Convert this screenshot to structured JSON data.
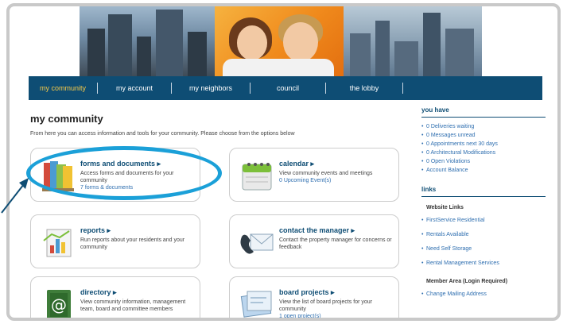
{
  "nav": {
    "items": [
      {
        "label": "my community",
        "active": true
      },
      {
        "label": "my account"
      },
      {
        "label": "my neighbors"
      },
      {
        "label": "council"
      },
      {
        "label": "the lobby"
      }
    ]
  },
  "main": {
    "title": "my community",
    "intro": "From here you can access information and tools for your community. Please choose from the options below",
    "cards": [
      {
        "title": "forms and documents ▸",
        "desc": "Access forms and documents for your community",
        "sub": "7 forms & documents",
        "icon": "folders-icon"
      },
      {
        "title": "calendar ▸",
        "desc": "View community events and meetings",
        "sub": "0 Upcoming Event(s)",
        "icon": "calendar-icon"
      },
      {
        "title": "reports ▸",
        "desc": "Run reports about your residents and your community",
        "sub": "",
        "icon": "chart-report-icon"
      },
      {
        "title": "contact the manager ▸",
        "desc": "Contact the property manager for concerns or feedback",
        "sub": "",
        "icon": "phone-envelope-icon"
      },
      {
        "title": "directory ▸",
        "desc": "View community information, management team, board and committee members",
        "sub": "",
        "icon": "at-book-icon"
      },
      {
        "title": "board projects ▸",
        "desc": "View the list of board projects for your community",
        "sub": "1 open project(s)",
        "icon": "blueprint-icon"
      }
    ]
  },
  "sidebar": {
    "you_have_title": "you have",
    "you_have": [
      "0 Deliveries waiting",
      "0 Messages unread",
      "0 Appointments next 30 days",
      "0 Architectural Modifications",
      "0 Open Violations",
      "Account Balance"
    ],
    "links_title": "links",
    "website_links_title": "Website Links",
    "website_links": [
      "FirstService Residential",
      "Rentals Available",
      "Need Self Storage",
      "Rental Management Services"
    ],
    "member_area_title": "Member Area (Login Required)",
    "member_links": [
      "Change Mailing Address"
    ]
  },
  "colors": {
    "nav_bg": "#0e4d74",
    "accent": "#1ba0d8",
    "link": "#2f6fb0",
    "active_nav": "#f7c948"
  }
}
